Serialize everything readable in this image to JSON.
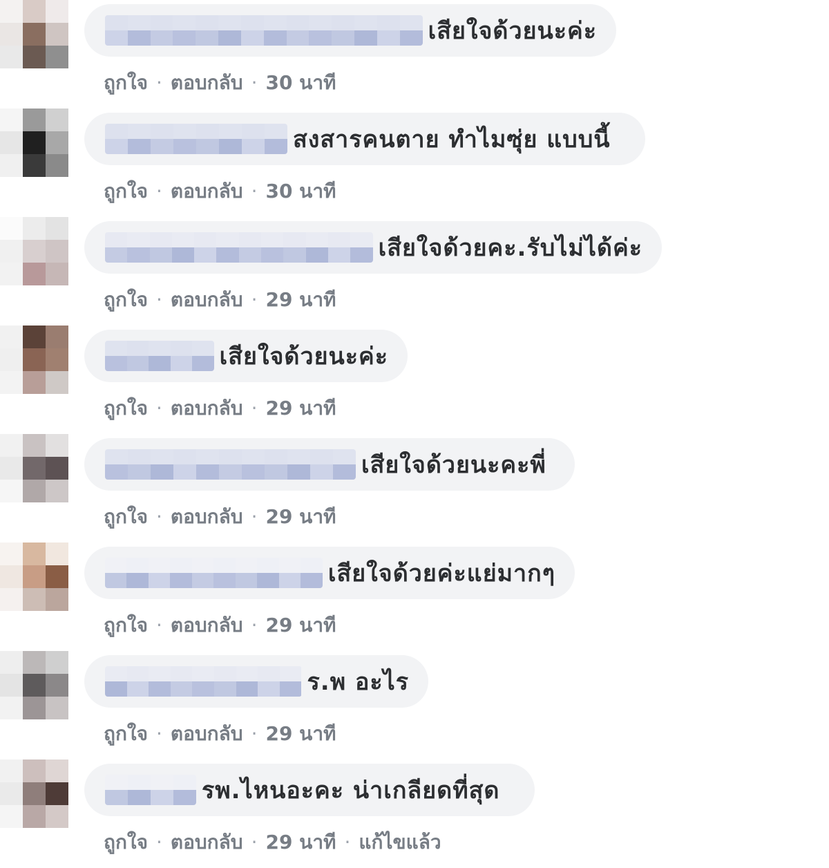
{
  "actions": {
    "like_label": "ถูกใจ",
    "reply_label": "ตอบกลับ"
  },
  "comments": [
    {
      "text": "เสียใจด้วยนะค่ะ",
      "time": "30 นาที",
      "edited": ""
    },
    {
      "text": "สงสารคนตาย ทำไมซุ่ย แบบนี้",
      "time": "30 นาที",
      "edited": ""
    },
    {
      "text": "เสียใจด้วยคะ.รับไม่ได้ค่ะ",
      "time": "29 นาที",
      "edited": ""
    },
    {
      "text": "เสียใจด้วยนะค่ะ",
      "time": "29 นาที",
      "edited": ""
    },
    {
      "text": "เสียใจด้วยนะคะพี่",
      "time": "29 นาที",
      "edited": ""
    },
    {
      "text": "เสียใจด้วยค่ะแย่มากๆ",
      "time": "29 นาที",
      "edited": ""
    },
    {
      "text": "ร.พ อะไร",
      "time": "29 นาที",
      "edited": ""
    },
    {
      "text": "รพ.ไหนอะคะ น่าเกลียดที่สุด",
      "time": "29 นาที",
      "edited": "แก้ไขแล้ว"
    }
  ],
  "colors": {
    "bubble_bg": "#f2f3f5",
    "action_text": "#606770",
    "censor_blue": "#b6bfdc"
  }
}
